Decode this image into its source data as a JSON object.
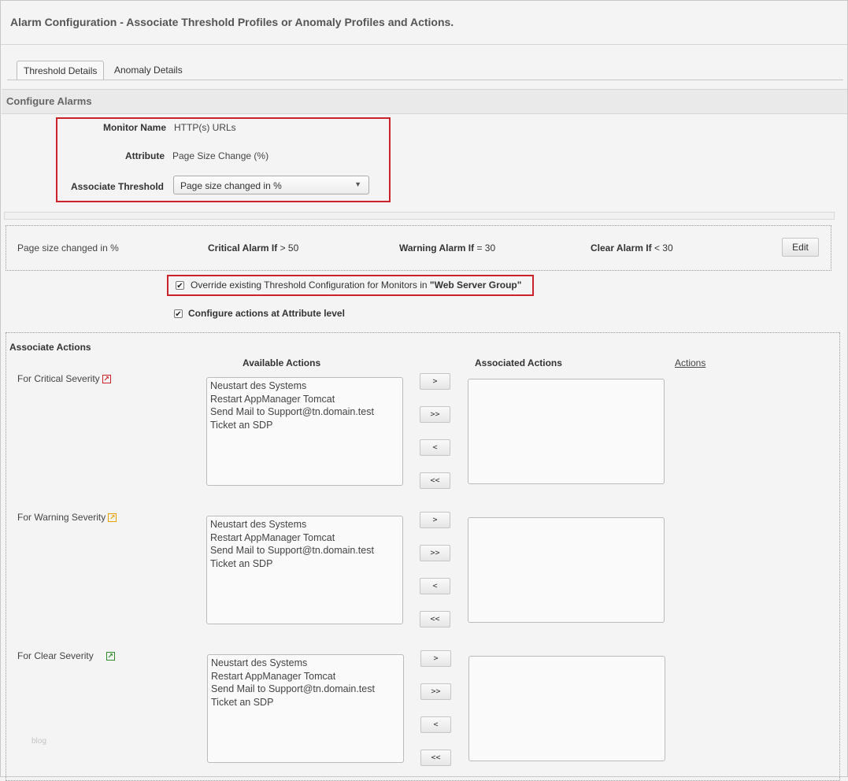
{
  "header": {
    "title": "Alarm Configuration - Associate Threshold Profiles or Anomaly Profiles and Actions."
  },
  "tabs": [
    {
      "label": "Threshold Details"
    },
    {
      "label": "Anomaly Details"
    }
  ],
  "section_title": "Configure Alarms",
  "form": {
    "monitor_name_label": "Monitor Name",
    "monitor_name_value": "HTTP(s) URLs",
    "attribute_label": "Attribute",
    "attribute_value": "Page Size Change (%)",
    "threshold_label": "Associate Threshold",
    "threshold_selected": "Page size changed in %"
  },
  "threshold_summary": {
    "name": "Page size changed in %",
    "critical_label": "Critical Alarm If",
    "critical_value": "> 50",
    "warning_label": "Warning Alarm If",
    "warning_value": "= 30",
    "clear_label": "Clear Alarm If",
    "clear_value": "< 30",
    "edit_label": "Edit"
  },
  "options": {
    "override_prefix": "Override existing Threshold Configuration for Monitors in ",
    "override_group": "\"Web Server Group\"",
    "override_checked": true,
    "attribute_level_label": "Configure actions at Attribute level",
    "attribute_level_checked": true
  },
  "actions": {
    "section_title": "Associate Actions",
    "available_header": "Available Actions",
    "associated_header": "Associated Actions",
    "actions_link": "Actions",
    "move_buttons": [
      ">",
      ">>",
      "<",
      "<<"
    ],
    "available": [
      "Neustart des Systems",
      "Restart AppManager Tomcat",
      "Send Mail to Support@tn.domain.test",
      "Ticket an SDP"
    ],
    "severities": [
      {
        "label": "For Critical Severity",
        "color": "#cc2229"
      },
      {
        "label": "For Warning Severity",
        "color": "#e8a000"
      },
      {
        "label": "For Clear Severity",
        "color": "#2e8b2e"
      }
    ]
  },
  "watermark": "blog"
}
